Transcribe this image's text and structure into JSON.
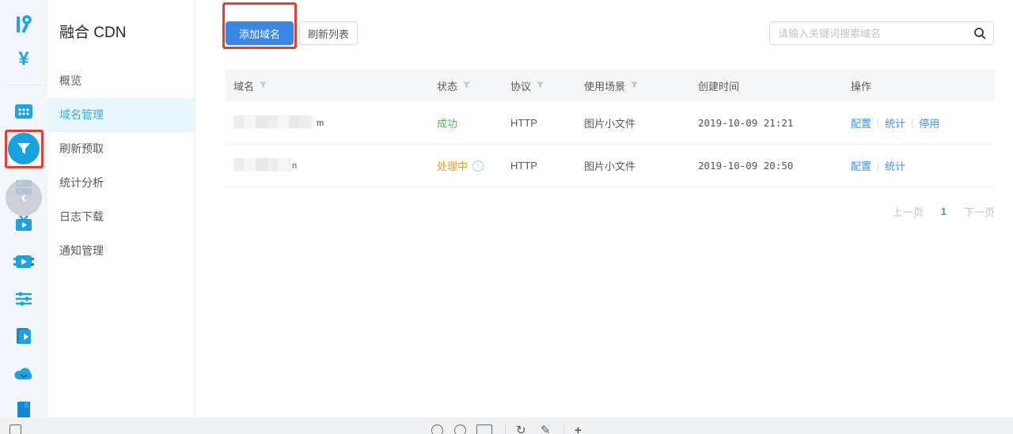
{
  "sidebar": {
    "title": "融合 CDN",
    "items": [
      {
        "label": "概览",
        "active": false
      },
      {
        "label": "域名管理",
        "active": true
      },
      {
        "label": "刷新预取",
        "active": false
      },
      {
        "label": "统计分析",
        "active": false
      },
      {
        "label": "日志下载",
        "active": false
      },
      {
        "label": "通知管理",
        "active": false
      }
    ]
  },
  "icon_rail": {
    "icons": [
      "logo-r-icon",
      "currency-yen-icon",
      "grid-keypad-icon",
      "cdn-funnel-icon",
      "server-list-icon",
      "tv-play-icon",
      "video-chip-icon",
      "sliders-icon",
      "doc-play-icon",
      "cloud-icon",
      "book-icon"
    ],
    "collapse_glyph": "‹",
    "active_icon": "cdn-funnel-icon"
  },
  "toolbar": {
    "add_domain_label": "添加域名",
    "refresh_list_label": "刷新列表"
  },
  "search": {
    "placeholder": "请输入关键词搜索域名"
  },
  "table": {
    "headers": [
      {
        "label": "域名",
        "filter": true
      },
      {
        "label": "状态",
        "filter": true
      },
      {
        "label": "协议",
        "filter": true
      },
      {
        "label": "使用场景",
        "filter": true
      },
      {
        "label": "创建时间",
        "filter": false
      },
      {
        "label": "操作",
        "filter": false
      }
    ],
    "rows": [
      {
        "domain_redacted": true,
        "domain_visible_tail": "m",
        "status": "成功",
        "status_type": "success",
        "protocol": "HTTP",
        "scene": "图片小文件",
        "created": "2019-10-09 21:21",
        "actions": [
          "配置",
          "统计",
          "停用"
        ]
      },
      {
        "domain_redacted": true,
        "domain_visible_tail": "n",
        "status": "处理中",
        "status_type": "pending",
        "has_info_icon": true,
        "protocol": "HTTP",
        "scene": "图片小文件",
        "created": "2019-10-09 20:50",
        "actions": [
          "配置",
          "统计"
        ]
      }
    ]
  },
  "pagination": {
    "prev": "上一页",
    "current": "1",
    "next": "下一页"
  },
  "colors": {
    "accent_blue": "#3a87e8",
    "link_blue": "#3e8ff2",
    "icon_blue": "#1ea2e2",
    "active_menu_blue": "#3aabe6",
    "success_green": "#42c157",
    "pending_orange": "#f59b23",
    "annotation_red": "#ea3b2d"
  }
}
